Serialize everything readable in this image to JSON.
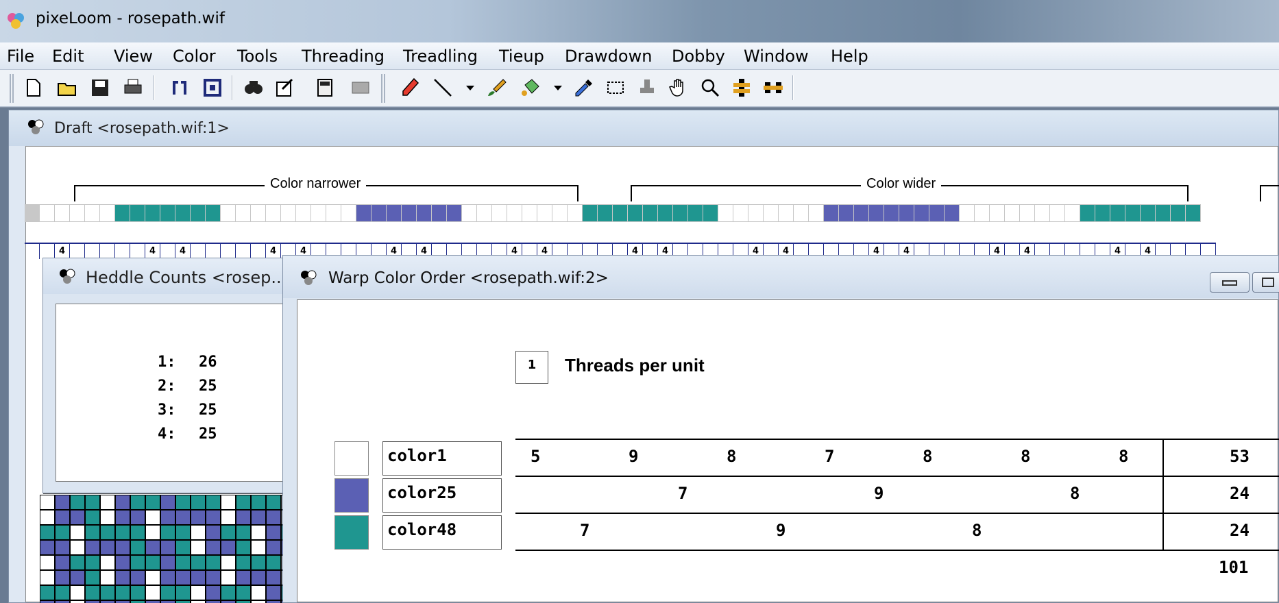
{
  "app": {
    "title": "pixeLoom - rosepath.wif"
  },
  "menu": [
    "File",
    "Edit",
    "View",
    "Color",
    "Tools",
    "Threading",
    "Treadling",
    "Tieup",
    "Drawdown",
    "Dobby",
    "Window",
    "Help"
  ],
  "toolbar": {
    "icons": [
      "new-icon",
      "open-icon",
      "save-icon",
      "print-icon",
      "threading-icon",
      "tieup-icon",
      "find-icon",
      "properties-icon",
      "calculator-icon",
      "pattern-icon",
      "pencil-icon",
      "line-icon",
      "paint-brush-icon",
      "fill-icon",
      "eyedropper-icon",
      "select-rect-icon",
      "stamp-icon",
      "hand-icon",
      "zoom-icon",
      "weave-icon",
      "dobby-icon"
    ]
  },
  "draft": {
    "title": "Draft <rosepath.wif:1>",
    "label_narrower": "Color narrower",
    "label_wider": "Color wider",
    "thread_mark": "4",
    "colors": {
      "white": "#ffffff",
      "blue": "#5b60b4",
      "teal": "#1f9690"
    }
  },
  "heddle": {
    "title": "Heddle Counts <rosep...",
    "rows": [
      {
        "k": "1:",
        "v": "26"
      },
      {
        "k": "2:",
        "v": "25"
      },
      {
        "k": "3:",
        "v": "25"
      },
      {
        "k": "4:",
        "v": "25"
      }
    ]
  },
  "warp": {
    "title": "Warp Color Order <rosepath.wif:2>",
    "threads_per_unit_value": "1",
    "threads_per_unit_label": "Threads per unit",
    "rows": [
      {
        "name": "color1",
        "color": "#ffffff",
        "counts": [
          "5",
          "9",
          "8",
          "7",
          "8",
          "8",
          "8"
        ],
        "total": "53"
      },
      {
        "name": "color25",
        "color": "#5b60b4",
        "counts": [
          "7",
          "9",
          "8"
        ],
        "total": "24"
      },
      {
        "name": "color48",
        "color": "#1f9690",
        "counts": [
          "7",
          "9",
          "8"
        ],
        "total": "24"
      }
    ],
    "grand_total": "101"
  }
}
